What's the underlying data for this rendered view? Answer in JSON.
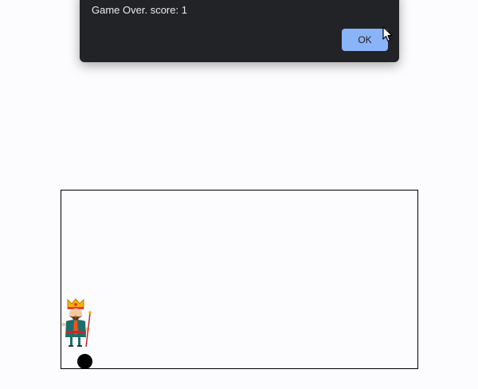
{
  "dialog": {
    "message": "Game Over. score: 1",
    "ok_label": "OK",
    "button_color": "#8ab4f8",
    "background_color": "#222327"
  },
  "game": {
    "player_icon": "king-character-icon",
    "obstacle_icon": "ball-icon"
  }
}
